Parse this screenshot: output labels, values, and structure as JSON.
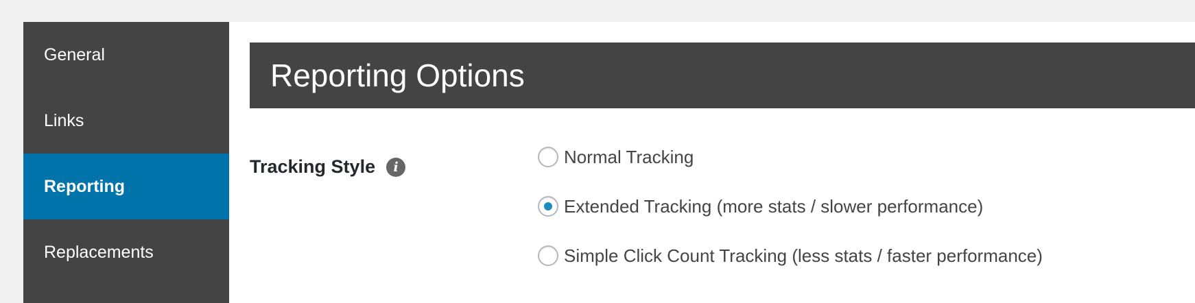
{
  "sidebar": {
    "items": [
      {
        "label": "General",
        "active": false
      },
      {
        "label": "Links",
        "active": false
      },
      {
        "label": "Reporting",
        "active": true
      },
      {
        "label": "Replacements",
        "active": false
      }
    ]
  },
  "main": {
    "title": "Reporting Options",
    "tracking_style": {
      "label": "Tracking Style",
      "info_icon": "info-icon",
      "options": [
        {
          "label": "Normal Tracking",
          "checked": false
        },
        {
          "label": "Extended Tracking (more stats / slower performance)",
          "checked": true
        },
        {
          "label": "Simple Click Count Tracking (less stats / faster performance)",
          "checked": false
        }
      ]
    }
  },
  "colors": {
    "sidebar_bg": "#444444",
    "active_bg": "#0073aa",
    "radio_dot": "#1e8cbe"
  }
}
